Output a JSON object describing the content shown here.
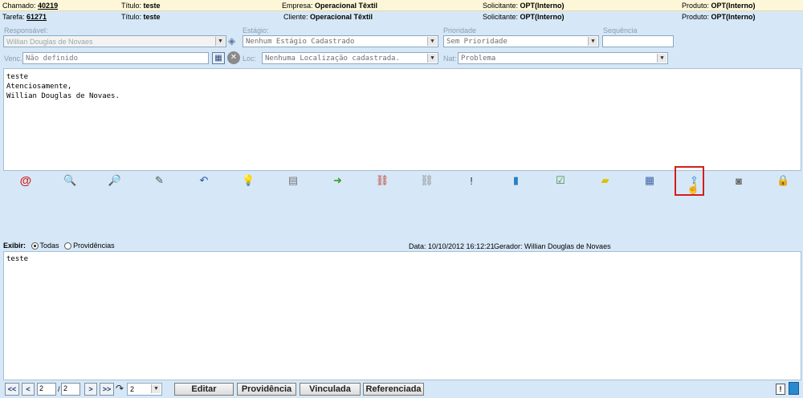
{
  "header": {
    "chamado_label": "Chamado:",
    "chamado_value": "40219",
    "titulo1_label": "Título:",
    "titulo1_value": "teste",
    "empresa_label": "Empresa:",
    "empresa_value": "Operacional Têxtil",
    "solicitante1_label": "Solicitante:",
    "solicitante1_value": "OPT(Interno)",
    "produto1_label": "Produto:",
    "produto1_value": "OPT(Interno)",
    "tarefa_label": "Tarefa:",
    "tarefa_value": "61271",
    "titulo2_label": "Título:",
    "titulo2_value": "teste",
    "cliente_label": "Cliente:",
    "cliente_value": "Operacional Têxtil",
    "solicitante2_label": "Solicitante:",
    "solicitante2_value": "OPT(Interno)",
    "produto2_label": "Produto:",
    "produto2_value": "OPT(Interno)"
  },
  "form": {
    "responsavel_label": "Responsável:",
    "responsavel_value": "Willian Douglas de Novaes",
    "estagio_label": "Estágio:",
    "estagio_value": "Nenhum Estágio Cadastrado",
    "prioridade_label": "Prioridade",
    "prioridade_value": "Sem Prioridade",
    "sequencia_label": "Sequência",
    "sequencia_value": "",
    "venc_label": "Venc.",
    "venc_value": "Não definido",
    "loc_label": "Loc:",
    "loc_value": "Nenhuma Localização cadastrada.",
    "nat_label": "Nat:",
    "nat_value": "Problema"
  },
  "message": {
    "text": "teste\nAtenciosamente,\nWillian Douglas de Novaes."
  },
  "toolbar": {
    "icons": [
      {
        "name": "email-icon",
        "glyph": "@",
        "color": "#d62020"
      },
      {
        "name": "search-document-icon",
        "glyph": "🔍",
        "color": "#8a6a20"
      },
      {
        "name": "zoom-icon",
        "glyph": "🔎",
        "color": "#4477aa"
      },
      {
        "name": "edit-icon",
        "glyph": "✎",
        "color": "#555555"
      },
      {
        "name": "undo-icon",
        "glyph": "↶",
        "color": "#2255aa"
      },
      {
        "name": "lightbulb-icon",
        "glyph": "💡",
        "color": "#c9a200"
      },
      {
        "name": "document-icon",
        "glyph": "▤",
        "color": "#777777"
      },
      {
        "name": "forward-icon",
        "glyph": "➜",
        "color": "#3a9a2a"
      },
      {
        "name": "link-icon",
        "glyph": "⛓",
        "color": "#c0392b"
      },
      {
        "name": "chain-icon",
        "glyph": "⛓",
        "color": "#888888"
      },
      {
        "name": "alert-icon",
        "glyph": "!",
        "color": "#333333"
      },
      {
        "name": "book-icon",
        "glyph": "▮",
        "color": "#2a7fc0"
      },
      {
        "name": "checklist-icon",
        "glyph": "☑",
        "color": "#4a8a3a"
      },
      {
        "name": "note-icon",
        "glyph": "▰",
        "color": "#e0c000"
      },
      {
        "name": "calendar-icon",
        "glyph": "▦",
        "color": "#4466aa"
      },
      {
        "name": "upload-icon",
        "glyph": "⇪",
        "color": "#2a7fc0"
      },
      {
        "name": "camera-icon",
        "glyph": "◙",
        "color": "#666666"
      },
      {
        "name": "lock-icon",
        "glyph": "🔒",
        "color": "#777777"
      }
    ]
  },
  "filter": {
    "exibir_label": "Exibir:",
    "todas_label": "Todas",
    "providencias_label": "Providências",
    "data_text": "Data: 10/10/2012 16:12:21",
    "gerador_text": "Gerador: Willian Douglas de Novaes"
  },
  "history": {
    "text": "teste"
  },
  "pager": {
    "first": "<<",
    "prev": "<",
    "current": "2",
    "separator": "/",
    "total": "2",
    "next": ">",
    "last": ">>",
    "goto_value": "2"
  },
  "buttons": {
    "editar": "Editar",
    "providencia": "Providência",
    "vinculada": "Vinculada",
    "referenciada": "Referenciada"
  }
}
